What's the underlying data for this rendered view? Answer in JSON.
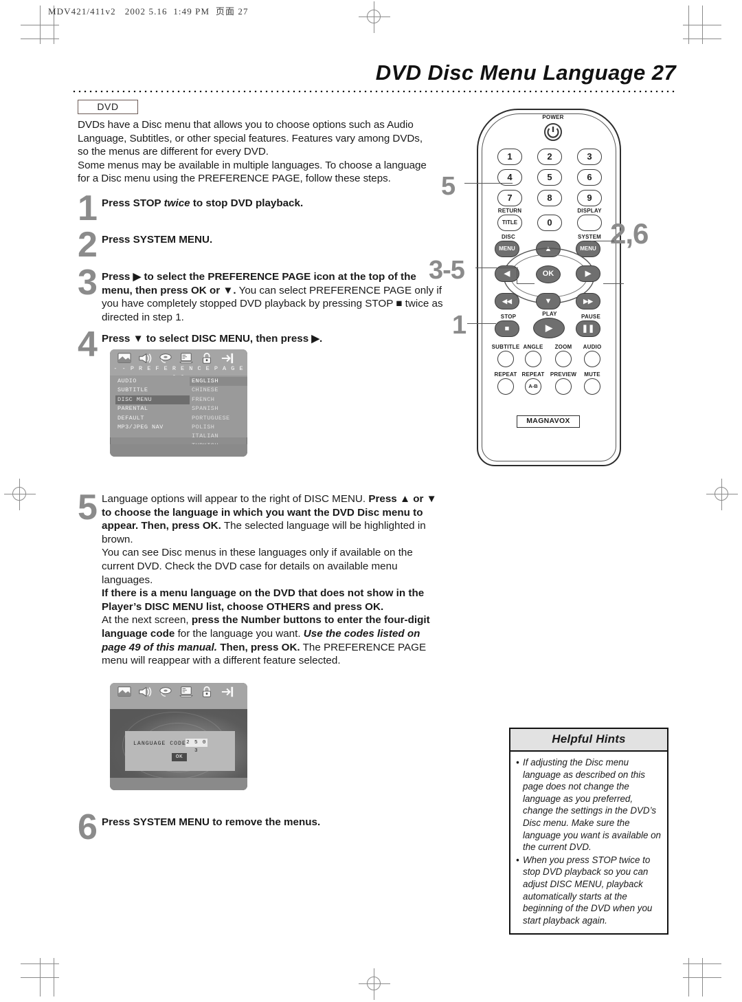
{
  "running_head": "MDV421/411v2   2002 5.16  1:49 PM  页面 27",
  "page": {
    "title": "DVD Disc Menu Language  27",
    "badge": "DVD",
    "intro": "DVDs have a Disc menu that allows you to choose options such as Audio Language, Subtitles, or other special features. Features vary among DVDs, so the menus are different for every DVD.\nSome menus may be available in multiple languages. To choose a language for a Disc menu using the PREFERENCE PAGE, follow these steps."
  },
  "steps": [
    {
      "num": "1",
      "html": "<b>Press STOP <i>twice</i> to stop DVD playback.</b>"
    },
    {
      "num": "2",
      "html": "<b>Press SYSTEM MENU.</b>"
    },
    {
      "num": "3",
      "html": "<b>Press ▶ to select the PREFERENCE PAGE icon at the top of the menu, then press OK or ▼.</b> You can select PREFERENCE PAGE only if you have completely stopped DVD playback by pressing STOP ■ twice as directed in step 1."
    },
    {
      "num": "4",
      "html": "<b>Press ▼ to select DISC MENU, then press ▶.</b>"
    },
    {
      "num": "5",
      "html": "Language options will appear to the right of DISC MENU. <b>Press ▲ or ▼ to choose the language in which you want the DVD Disc menu to appear. Then, press OK.</b> The selected language will be highlighted in brown.<br>You can see Disc menus in these languages only if available on the current DVD. Check the DVD case for details on available menu languages.<br><b>If there is a menu language on the DVD that does not show in the Player’s DISC MENU list, choose OTHERS and press OK.</b><br>At the next screen, <b>press the Number buttons to enter the four-digit language code</b> for the language you want. <span class=\"bi\">Use the codes listed on page 49 of this manual.</span> <b>Then, press OK.</b> The PREFERENCE PAGE menu will reappear with a different feature selected."
    },
    {
      "num": "6",
      "html": "<b>Press SYSTEM MENU to remove the menus.</b>"
    }
  ],
  "tv_preference": {
    "icons": [
      "general-icon",
      "audio-icon",
      "video-icon",
      "preference-icon",
      "parental-lock-icon",
      "exit-icon"
    ],
    "header": "- -  P R E F E R E N C E   P A G E  - -",
    "menu_items": [
      "AUDIO",
      "SUBTITLE",
      "DISC MENU",
      "PARENTAL",
      "DEFAULT",
      "MP3/JPEG NAV"
    ],
    "menu_selected": "DISC MENU",
    "languages": [
      "ENGLISH",
      "CHINESE",
      "FRENCH",
      "SPANISH",
      "PORTUGUESE",
      "POLISH",
      "ITALIAN",
      "TURKISH"
    ],
    "language_selected": "ENGLISH"
  },
  "tv_language_code": {
    "label": "LANGUAGE  CODE",
    "code": "2 5 0 3",
    "ok_label": "OK"
  },
  "remote": {
    "brand": "MAGNAVOX",
    "power_label": "POWER",
    "numbers": [
      "1",
      "2",
      "3",
      "4",
      "5",
      "6",
      "7",
      "8",
      "9",
      "0"
    ],
    "return_label": "RETURN",
    "title_label": "TITLE",
    "display_label": "DISPLAY",
    "disc_label": "DISC",
    "disc_menu_label": "MENU",
    "system_label": "SYSTEM",
    "system_menu_label": "MENU",
    "ok_label": "OK",
    "stop_label": "STOP",
    "play_label": "PLAY",
    "pause_label": "PAUSE",
    "func_row1": [
      "SUBTITLE",
      "ANGLE",
      "ZOOM",
      "AUDIO"
    ],
    "func_row2": [
      "REPEAT",
      "REPEAT",
      "PREVIEW",
      "MUTE"
    ],
    "repeat_ab_label": "A-B",
    "callouts": {
      "numbers": "5",
      "navigation": "3-5",
      "stop": "1",
      "system_menu": "2,6"
    }
  },
  "helpful_hints": {
    "title": "Helpful Hints",
    "items": [
      "If adjusting the Disc menu language as described on this page does not change the language as you preferred, change the settings in the DVD’s Disc menu. Make sure the language you want is available on the current DVD.",
      "When you press STOP twice to stop DVD playback so you can adjust DISC MENU, playback automatically starts at the beginning of the DVD when you start playback again."
    ]
  },
  "colors": {
    "step_number": "#8b8b8b",
    "title": "#111111",
    "hints_header_bg": "#e2e2e2",
    "screen_bg": "#8e8e8e"
  }
}
